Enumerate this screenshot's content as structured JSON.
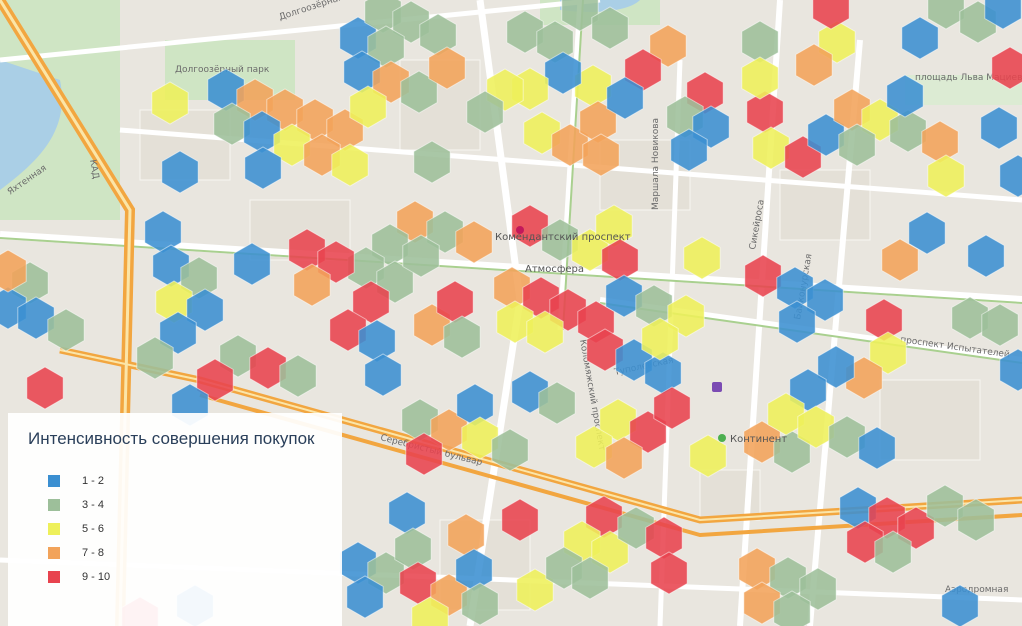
{
  "legend": {
    "title": "Интенсивность совершения покупок",
    "items": [
      {
        "label": "1 - 2",
        "color": "#3b8fd1"
      },
      {
        "label": "3 - 4",
        "color": "#9dbf9a"
      },
      {
        "label": "5 - 6",
        "color": "#eef05a"
      },
      {
        "label": "7 - 8",
        "color": "#f2a35a"
      },
      {
        "label": "9 - 10",
        "color": "#e8434e"
      }
    ]
  },
  "streets": {
    "dolgoozernaya": "Долгоозёрная",
    "dolgoozerny_park": "Долгоозёрный парк",
    "komendantsky": "Комендантский проспект",
    "baykonurskaya": "Байконурская",
    "ispytateley": "проспект Испытателей",
    "sikeyrosa": "Сикейроса",
    "marshala_novikova": "Маршала Новикова",
    "tupolevskaya": "Туполевская",
    "kolomyazhsky": "Коломяжский проспект",
    "yatmenskaya": "Яхтенная",
    "ploshchad": "площадь Льва Мациевича",
    "aerodromnaya": "Аэродромная",
    "serebristy": "Серебристый бульвар",
    "kad": "КАД"
  },
  "pois": {
    "kontinent": "Континент",
    "atmosfera": "Атмосфера",
    "komendantsky_metro": "Комендантский проспект"
  }
}
